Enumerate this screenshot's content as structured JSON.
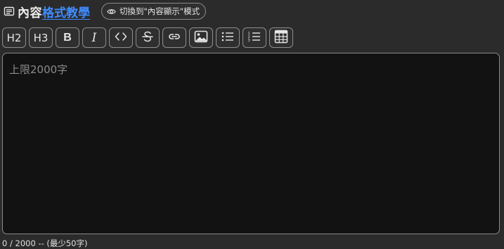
{
  "header": {
    "title_prefix": "內容",
    "title_link": "格式教學",
    "mode_button_label": "切換到\"內容顯示\"模式"
  },
  "toolbar": {
    "h2_label": "H2",
    "h3_label": "H3",
    "bold_label": "B",
    "italic_label": "I",
    "icons": [
      "code-icon",
      "strikethrough-icon",
      "link-icon",
      "image-icon",
      "bullet-list-icon",
      "numbered-list-icon",
      "table-icon"
    ]
  },
  "editor": {
    "value": "",
    "placeholder": "上限2000字"
  },
  "counter": {
    "text": "0 / 2000 -- (最少50字)"
  },
  "colors": {
    "background": "#2b2b2b",
    "editor_background": "#121212",
    "link": "#3f8cff",
    "border": "#8a8a8a"
  }
}
